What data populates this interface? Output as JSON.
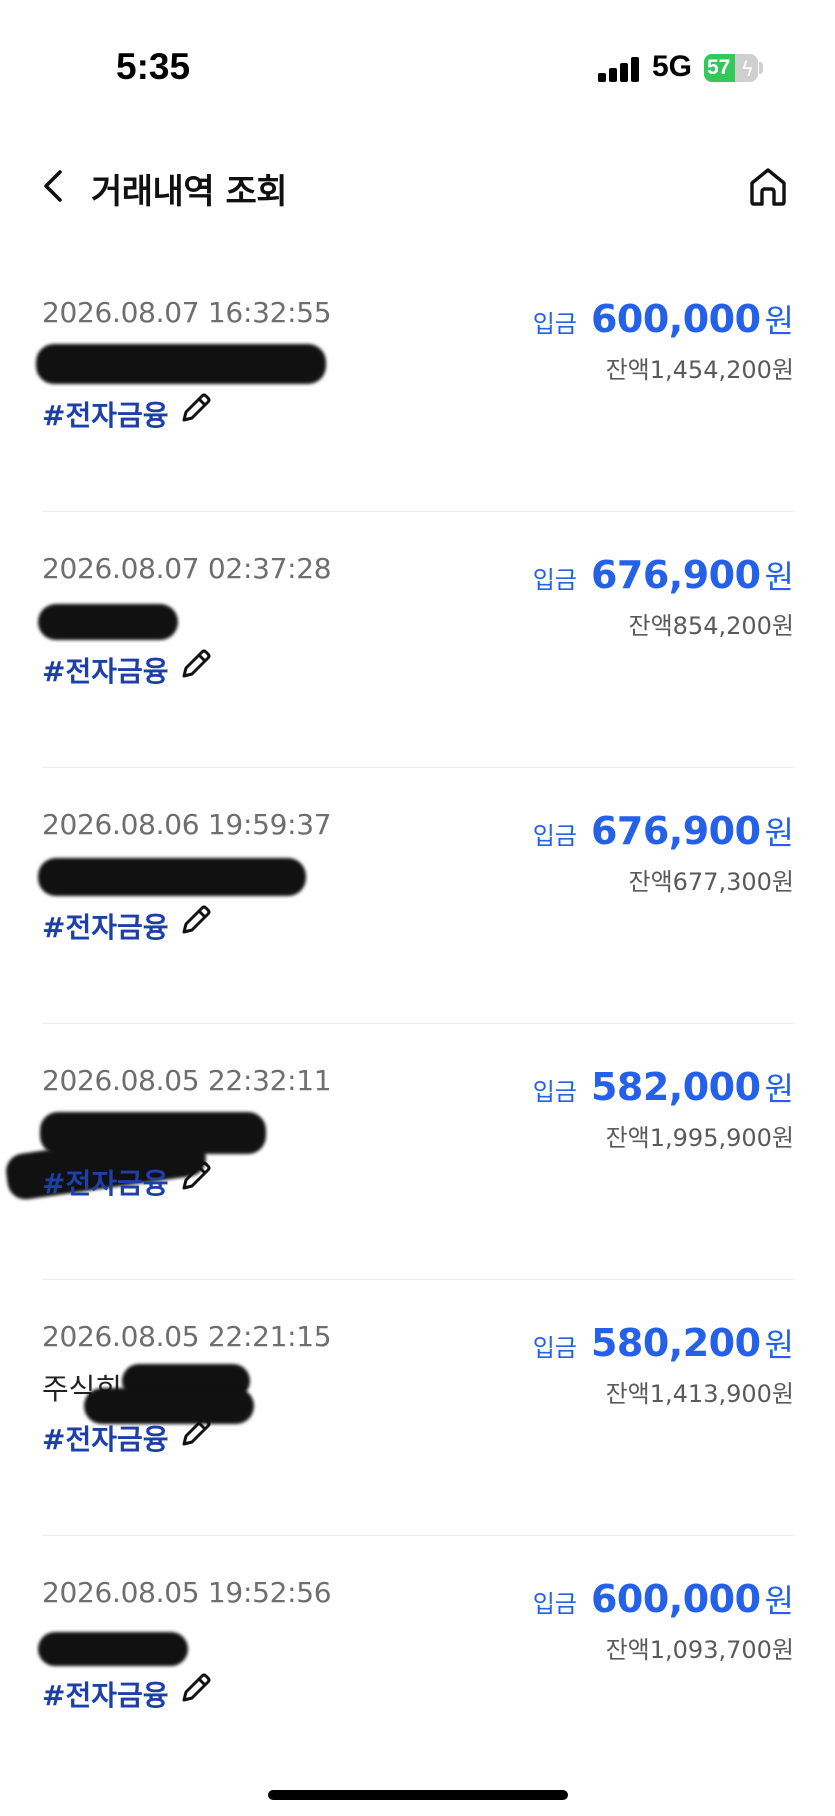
{
  "status_bar": {
    "time": "5:35",
    "network": "5G",
    "battery_percent": "57",
    "battery_level": 0.57
  },
  "header": {
    "title": "거래내역 조회",
    "back_icon": "chevron-left-icon",
    "home_icon": "home-icon"
  },
  "transactions": [
    {
      "datetime": "2026.08.07 16:32:55",
      "memo_visible": "",
      "tag": "#전자금융",
      "type": "입금",
      "amount": "600,000",
      "unit": "원",
      "balance_label": "잔액",
      "balance": "1,454,200",
      "balance_unit": "원"
    },
    {
      "datetime": "2026.08.07 02:37:28",
      "memo_visible": "",
      "tag": "#전자금융",
      "type": "입금",
      "amount": "676,900",
      "unit": "원",
      "balance_label": "잔액",
      "balance": "854,200",
      "balance_unit": "원"
    },
    {
      "datetime": "2026.08.06 19:59:37",
      "memo_visible": "",
      "tag": "#전자금융",
      "type": "입금",
      "amount": "676,900",
      "unit": "원",
      "balance_label": "잔액",
      "balance": "677,300",
      "balance_unit": "원"
    },
    {
      "datetime": "2026.08.05 22:32:11",
      "memo_visible": "",
      "tag": "#전자금융",
      "type": "입금",
      "amount": "582,000",
      "unit": "원",
      "balance_label": "잔액",
      "balance": "1,995,900",
      "balance_unit": "원"
    },
    {
      "datetime": "2026.08.05 22:21:15",
      "memo_visible": "주식회",
      "tag": "#전자금융",
      "type": "입금",
      "amount": "580,200",
      "unit": "원",
      "balance_label": "잔액",
      "balance": "1,413,900",
      "balance_unit": "원"
    },
    {
      "datetime": "2026.08.05 19:52:56",
      "memo_visible": "",
      "tag": "#전자금융",
      "type": "입금",
      "amount": "600,000",
      "unit": "원",
      "balance_label": "잔액",
      "balance": "1,093,700",
      "balance_unit": "원"
    }
  ],
  "colors": {
    "accent": "#2461e8",
    "tag": "#1c3fa8",
    "date": "#6e6e6e",
    "divider": "#ededed"
  }
}
